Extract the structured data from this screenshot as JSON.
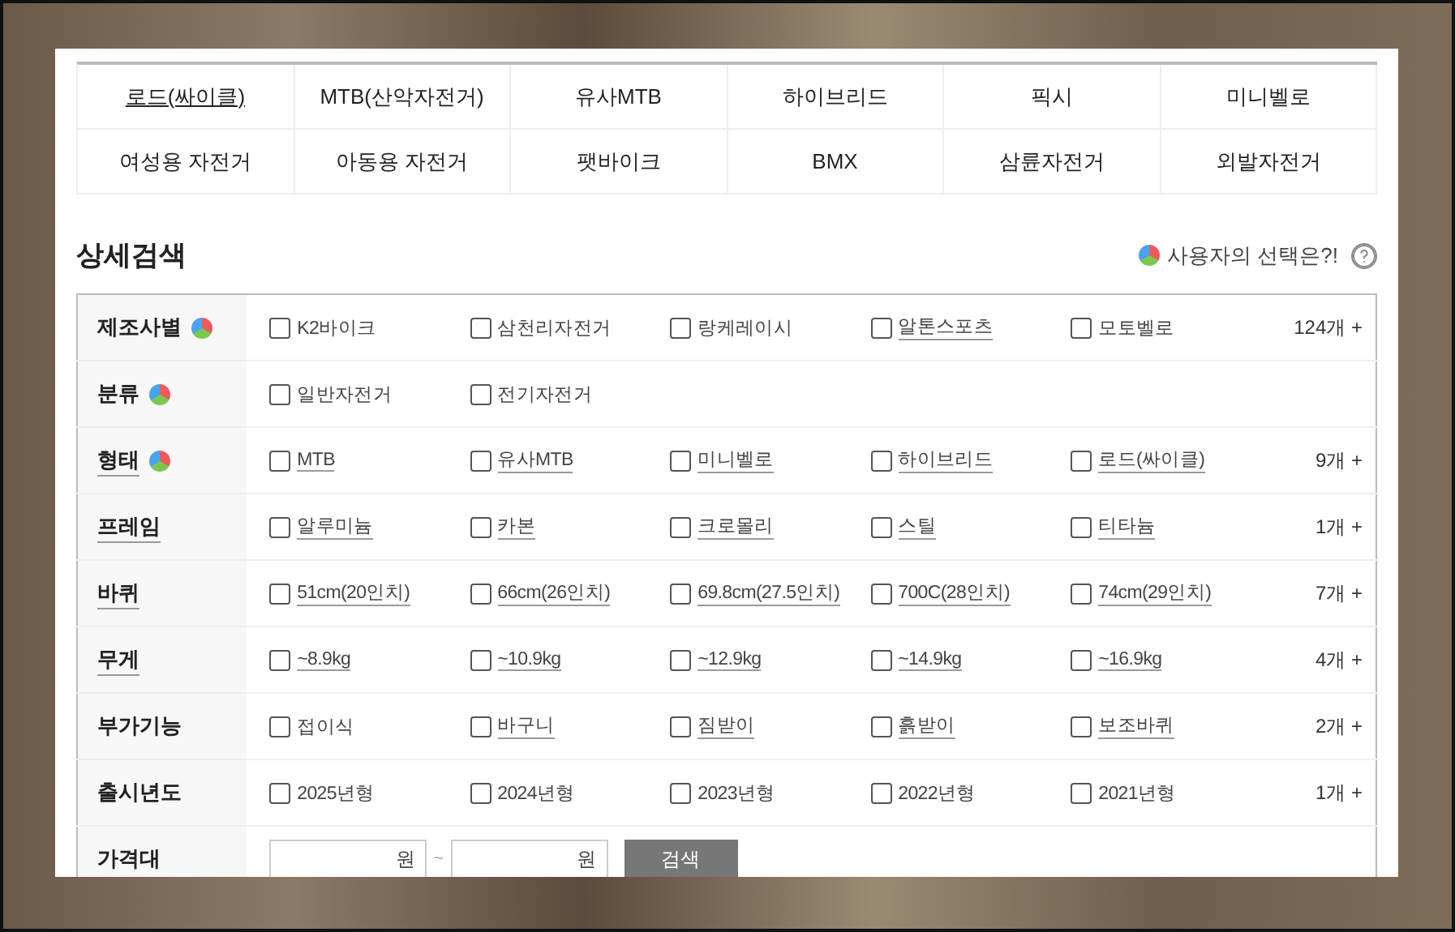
{
  "categories": [
    {
      "label": "로드(싸이클)",
      "selected": true
    },
    {
      "label": "MTB(산악자전거)",
      "selected": false
    },
    {
      "label": "유사MTB",
      "selected": false
    },
    {
      "label": "하이브리드",
      "selected": false
    },
    {
      "label": "픽시",
      "selected": false
    },
    {
      "label": "미니벨로",
      "selected": false
    },
    {
      "label": "여성용 자전거",
      "selected": false
    },
    {
      "label": "아동용 자전거",
      "selected": false
    },
    {
      "label": "팻바이크",
      "selected": false
    },
    {
      "label": "BMX",
      "selected": false
    },
    {
      "label": "삼륜자전거",
      "selected": false
    },
    {
      "label": "외발자전거",
      "selected": false
    }
  ],
  "detail_search": {
    "title": "상세검색",
    "user_choice": "사용자의 선택은?!"
  },
  "filters": [
    {
      "label": "제조사별",
      "pie": true,
      "linked": false,
      "count": "124개 +",
      "options": [
        {
          "label": "K2바이크",
          "checked": false,
          "linked": false
        },
        {
          "label": "삼천리자전거",
          "checked": false,
          "linked": false
        },
        {
          "label": "랑케레이시",
          "checked": false,
          "linked": false
        },
        {
          "label": "알톤스포츠",
          "checked": false,
          "linked": true
        },
        {
          "label": "모토벨로",
          "checked": false,
          "linked": false
        }
      ]
    },
    {
      "label": "분류",
      "pie": true,
      "linked": false,
      "options": [
        {
          "label": "일반자전거",
          "checked": false,
          "linked": false
        },
        {
          "label": "전기자전거",
          "checked": false,
          "linked": false
        }
      ]
    },
    {
      "label": "형태",
      "pie": true,
      "linked": true,
      "count": "9개 +",
      "options": [
        {
          "label": "MTB",
          "checked": false,
          "linked": true
        },
        {
          "label": "유사MTB",
          "checked": false,
          "linked": true
        },
        {
          "label": "미니벨로",
          "checked": false,
          "linked": true
        },
        {
          "label": "하이브리드",
          "checked": false,
          "linked": true
        },
        {
          "label": "로드(싸이클)",
          "checked": false,
          "linked": true
        }
      ]
    },
    {
      "label": "프레임",
      "pie": false,
      "linked": true,
      "count": "1개 +",
      "options": [
        {
          "label": "알루미늄",
          "checked": false,
          "linked": true
        },
        {
          "label": "카본",
          "checked": false,
          "linked": true
        },
        {
          "label": "크로몰리",
          "checked": false,
          "linked": true
        },
        {
          "label": "스틸",
          "checked": false,
          "linked": true
        },
        {
          "label": "티타늄",
          "checked": false,
          "linked": true
        }
      ]
    },
    {
      "label": "바퀴",
      "pie": false,
      "linked": true,
      "count": "7개 +",
      "options": [
        {
          "label": "51cm(20인치)",
          "checked": false,
          "linked": true
        },
        {
          "label": "66cm(26인치)",
          "checked": false,
          "linked": true
        },
        {
          "label": "69.8cm(27.5인치)",
          "checked": false,
          "linked": true
        },
        {
          "label": "700C(28인치)",
          "checked": false,
          "linked": true
        },
        {
          "label": "74cm(29인치)",
          "checked": false,
          "linked": true
        }
      ]
    },
    {
      "label": "무게",
      "pie": false,
      "linked": true,
      "count": "4개 +",
      "options": [
        {
          "label": "~8.9kg",
          "checked": false,
          "linked": true
        },
        {
          "label": "~10.9kg",
          "checked": false,
          "linked": true
        },
        {
          "label": "~12.9kg",
          "checked": false,
          "linked": true
        },
        {
          "label": "~14.9kg",
          "checked": false,
          "linked": true
        },
        {
          "label": "~16.9kg",
          "checked": false,
          "linked": true
        }
      ]
    },
    {
      "label": "부가기능",
      "pie": false,
      "linked": false,
      "count": "2개 +",
      "options": [
        {
          "label": "접이식",
          "checked": false,
          "linked": false
        },
        {
          "label": "바구니",
          "checked": false,
          "linked": true
        },
        {
          "label": "짐받이",
          "checked": false,
          "linked": true
        },
        {
          "label": "흙받이",
          "checked": false,
          "linked": true
        },
        {
          "label": "보조바퀴",
          "checked": false,
          "linked": true
        }
      ]
    },
    {
      "label": "출시년도",
      "pie": false,
      "linked": false,
      "count": "1개 +",
      "options": [
        {
          "label": "2025년형",
          "checked": false,
          "linked": false
        },
        {
          "label": "2024년형",
          "checked": false,
          "linked": false
        },
        {
          "label": "2023년형",
          "checked": false,
          "linked": false
        },
        {
          "label": "2022년형",
          "checked": false,
          "linked": false
        },
        {
          "label": "2021년형",
          "checked": false,
          "linked": false
        }
      ]
    }
  ],
  "price": {
    "label": "가격대",
    "min_unit": "원",
    "separator": "~",
    "max_unit": "원",
    "button": "검색"
  }
}
